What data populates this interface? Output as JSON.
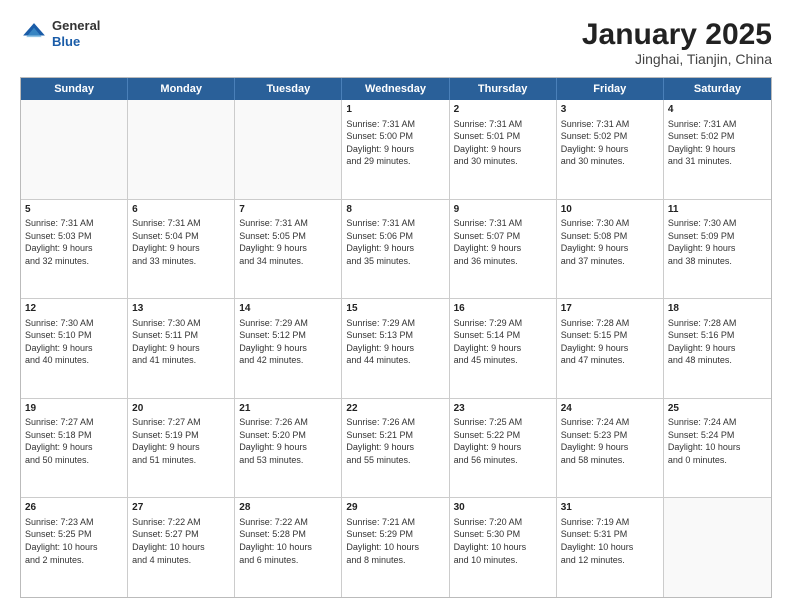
{
  "logo": {
    "general": "General",
    "blue": "Blue"
  },
  "header": {
    "month": "January 2025",
    "location": "Jinghai, Tianjin, China"
  },
  "weekdays": [
    "Sunday",
    "Monday",
    "Tuesday",
    "Wednesday",
    "Thursday",
    "Friday",
    "Saturday"
  ],
  "weeks": [
    [
      {
        "day": "",
        "text": ""
      },
      {
        "day": "",
        "text": ""
      },
      {
        "day": "",
        "text": ""
      },
      {
        "day": "1",
        "text": "Sunrise: 7:31 AM\nSunset: 5:00 PM\nDaylight: 9 hours\nand 29 minutes."
      },
      {
        "day": "2",
        "text": "Sunrise: 7:31 AM\nSunset: 5:01 PM\nDaylight: 9 hours\nand 30 minutes."
      },
      {
        "day": "3",
        "text": "Sunrise: 7:31 AM\nSunset: 5:02 PM\nDaylight: 9 hours\nand 30 minutes."
      },
      {
        "day": "4",
        "text": "Sunrise: 7:31 AM\nSunset: 5:02 PM\nDaylight: 9 hours\nand 31 minutes."
      }
    ],
    [
      {
        "day": "5",
        "text": "Sunrise: 7:31 AM\nSunset: 5:03 PM\nDaylight: 9 hours\nand 32 minutes."
      },
      {
        "day": "6",
        "text": "Sunrise: 7:31 AM\nSunset: 5:04 PM\nDaylight: 9 hours\nand 33 minutes."
      },
      {
        "day": "7",
        "text": "Sunrise: 7:31 AM\nSunset: 5:05 PM\nDaylight: 9 hours\nand 34 minutes."
      },
      {
        "day": "8",
        "text": "Sunrise: 7:31 AM\nSunset: 5:06 PM\nDaylight: 9 hours\nand 35 minutes."
      },
      {
        "day": "9",
        "text": "Sunrise: 7:31 AM\nSunset: 5:07 PM\nDaylight: 9 hours\nand 36 minutes."
      },
      {
        "day": "10",
        "text": "Sunrise: 7:30 AM\nSunset: 5:08 PM\nDaylight: 9 hours\nand 37 minutes."
      },
      {
        "day": "11",
        "text": "Sunrise: 7:30 AM\nSunset: 5:09 PM\nDaylight: 9 hours\nand 38 minutes."
      }
    ],
    [
      {
        "day": "12",
        "text": "Sunrise: 7:30 AM\nSunset: 5:10 PM\nDaylight: 9 hours\nand 40 minutes."
      },
      {
        "day": "13",
        "text": "Sunrise: 7:30 AM\nSunset: 5:11 PM\nDaylight: 9 hours\nand 41 minutes."
      },
      {
        "day": "14",
        "text": "Sunrise: 7:29 AM\nSunset: 5:12 PM\nDaylight: 9 hours\nand 42 minutes."
      },
      {
        "day": "15",
        "text": "Sunrise: 7:29 AM\nSunset: 5:13 PM\nDaylight: 9 hours\nand 44 minutes."
      },
      {
        "day": "16",
        "text": "Sunrise: 7:29 AM\nSunset: 5:14 PM\nDaylight: 9 hours\nand 45 minutes."
      },
      {
        "day": "17",
        "text": "Sunrise: 7:28 AM\nSunset: 5:15 PM\nDaylight: 9 hours\nand 47 minutes."
      },
      {
        "day": "18",
        "text": "Sunrise: 7:28 AM\nSunset: 5:16 PM\nDaylight: 9 hours\nand 48 minutes."
      }
    ],
    [
      {
        "day": "19",
        "text": "Sunrise: 7:27 AM\nSunset: 5:18 PM\nDaylight: 9 hours\nand 50 minutes."
      },
      {
        "day": "20",
        "text": "Sunrise: 7:27 AM\nSunset: 5:19 PM\nDaylight: 9 hours\nand 51 minutes."
      },
      {
        "day": "21",
        "text": "Sunrise: 7:26 AM\nSunset: 5:20 PM\nDaylight: 9 hours\nand 53 minutes."
      },
      {
        "day": "22",
        "text": "Sunrise: 7:26 AM\nSunset: 5:21 PM\nDaylight: 9 hours\nand 55 minutes."
      },
      {
        "day": "23",
        "text": "Sunrise: 7:25 AM\nSunset: 5:22 PM\nDaylight: 9 hours\nand 56 minutes."
      },
      {
        "day": "24",
        "text": "Sunrise: 7:24 AM\nSunset: 5:23 PM\nDaylight: 9 hours\nand 58 minutes."
      },
      {
        "day": "25",
        "text": "Sunrise: 7:24 AM\nSunset: 5:24 PM\nDaylight: 10 hours\nand 0 minutes."
      }
    ],
    [
      {
        "day": "26",
        "text": "Sunrise: 7:23 AM\nSunset: 5:25 PM\nDaylight: 10 hours\nand 2 minutes."
      },
      {
        "day": "27",
        "text": "Sunrise: 7:22 AM\nSunset: 5:27 PM\nDaylight: 10 hours\nand 4 minutes."
      },
      {
        "day": "28",
        "text": "Sunrise: 7:22 AM\nSunset: 5:28 PM\nDaylight: 10 hours\nand 6 minutes."
      },
      {
        "day": "29",
        "text": "Sunrise: 7:21 AM\nSunset: 5:29 PM\nDaylight: 10 hours\nand 8 minutes."
      },
      {
        "day": "30",
        "text": "Sunrise: 7:20 AM\nSunset: 5:30 PM\nDaylight: 10 hours\nand 10 minutes."
      },
      {
        "day": "31",
        "text": "Sunrise: 7:19 AM\nSunset: 5:31 PM\nDaylight: 10 hours\nand 12 minutes."
      },
      {
        "day": "",
        "text": ""
      }
    ]
  ]
}
